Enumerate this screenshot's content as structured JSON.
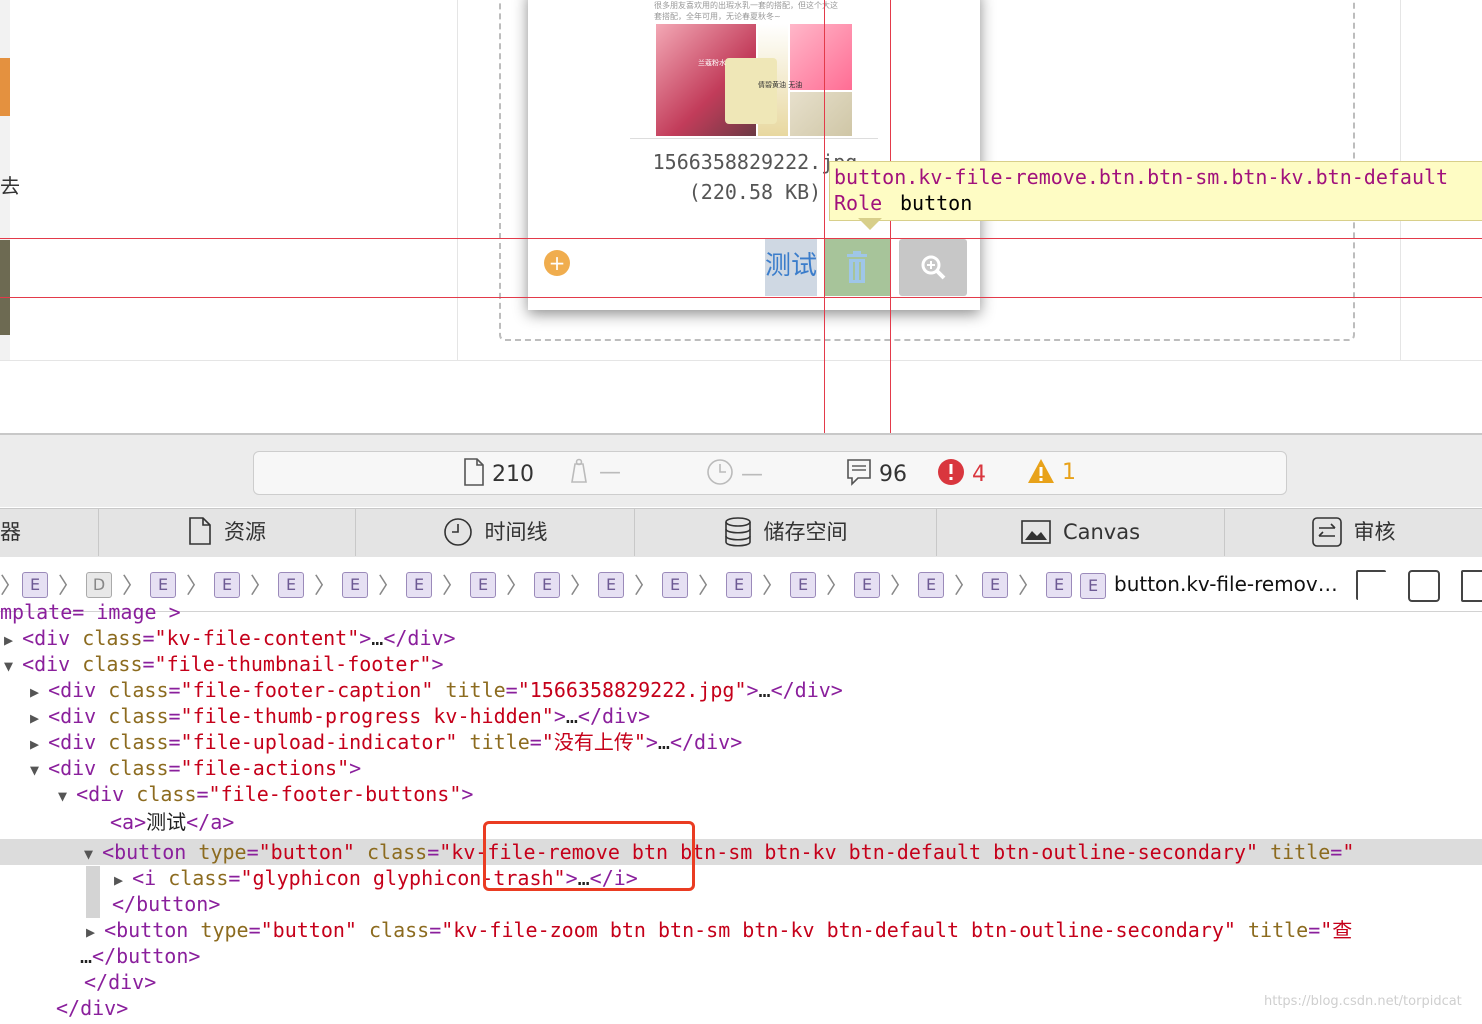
{
  "preview": {
    "left_char": "去",
    "thumb_caption_lines": [
      "很多朋友喜欢用的出瑕水乳一套的搭配，但这个大这",
      "套搭配，全年可用，无论春夏秋冬~"
    ],
    "photo_tag1": "兰蔻粉水",
    "photo_tag2": "倩碧黄油 无油",
    "file_name": "1566358829222.jpg",
    "file_size": "(220.58 KB)",
    "test_link": "测试",
    "tooltip_selector": "button.kv-file-remove.btn.btn-sm.btn-kv.btn-default",
    "tooltip_role_label": "Role",
    "tooltip_role_value": "button"
  },
  "dashboard": {
    "resources_count": "210",
    "size_placeholder": "—",
    "time_placeholder": "—",
    "logs_count": "96",
    "errors_count": "4",
    "warnings_count": "1"
  },
  "tabs": [
    "器",
    "资源",
    "时间线",
    "储存空间",
    "Canvas",
    "审核"
  ],
  "breadcrumb": {
    "items": [
      "E",
      "D",
      "E",
      "E",
      "E",
      "E",
      "E",
      "E",
      "E",
      "E",
      "E",
      "E",
      "E",
      "E",
      "E",
      "E",
      "E"
    ],
    "last": "button.kv-file-remov…"
  },
  "dom_lines": [
    {
      "text": "mplate= image >"
    },
    {
      "text": "<div class=\"kv-file-content\">…</div>"
    },
    {
      "text": "<div class=\"file-thumbnail-footer\">"
    },
    {
      "text": "<div class=\"file-footer-caption\" title=\"1566358829222.jpg\">…</div>"
    },
    {
      "text": "<div class=\"file-thumb-progress kv-hidden\">…</div>"
    },
    {
      "text": "<div class=\"file-upload-indicator\" title=\"没有上传\">…</div>"
    },
    {
      "text": "<div class=\"file-actions\">"
    },
    {
      "text": "<div class=\"file-footer-buttons\">"
    },
    {
      "text": "<a>测试</a>"
    },
    {
      "text": "<button type=\"button\" class=\"kv-file-remove btn btn-sm btn-kv btn-default btn-outline-secondary\" title=\""
    },
    {
      "text": "<i class=\"glyphicon glyphicon-trash\">…</i>"
    },
    {
      "text": "</button>"
    },
    {
      "text": "<button type=\"button\" class=\"kv-file-zoom btn btn-sm btn-kv btn-default btn-outline-secondary\" title=\"查"
    },
    {
      "text": "…</button>"
    },
    {
      "text": "</div>"
    },
    {
      "text": "</div>"
    }
  ],
  "watermark": "https://blog.csdn.net/torpidcat",
  "colors": {
    "guide": "#e33a4a",
    "tag": "#8a1f9c",
    "attr": "#8c6b1f",
    "value": "#c5001a",
    "highlight_box": "#ea3c22",
    "error": "#d9363e",
    "warning": "#e8a21a"
  }
}
